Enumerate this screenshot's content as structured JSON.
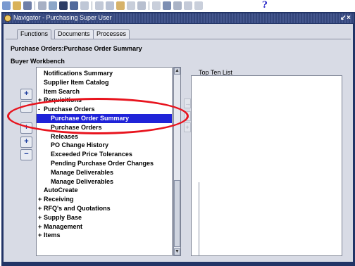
{
  "window": {
    "title": "Navigator - Purchasing Super User",
    "controls": [
      "↙",
      "×"
    ]
  },
  "toolbar": {
    "help_label": "?"
  },
  "tabs": [
    {
      "label": "Functions",
      "active": true
    },
    {
      "label": "Documents",
      "active": false
    },
    {
      "label": "Processes",
      "active": false
    }
  ],
  "breadcrumb": "Purchase Orders:Purchase Order Summary",
  "section_title": "Buyer Workbench",
  "side_buttons": [
    "+",
    "−",
    "+",
    "+",
    "−"
  ],
  "tree": {
    "items": [
      {
        "label": "Notifications Summary",
        "expander": "",
        "level": 0
      },
      {
        "label": "Supplier Item Catalog",
        "expander": "",
        "level": 0
      },
      {
        "label": "Item Search",
        "expander": "",
        "level": 0
      },
      {
        "label": "Requisitions",
        "expander": "+",
        "level": 0
      },
      {
        "label": "Purchase Orders",
        "expander": "-",
        "level": 0
      },
      {
        "label": "Purchase Order Summary",
        "expander": "",
        "level": 1,
        "selected": true
      },
      {
        "label": "Purchase Orders",
        "expander": "",
        "level": 1
      },
      {
        "label": "Releases",
        "expander": "",
        "level": 1
      },
      {
        "label": "PO Change History",
        "expander": "",
        "level": 1
      },
      {
        "label": "Exceeded Price Tolerances",
        "expander": "",
        "level": 1
      },
      {
        "label": "Pending Purchase Order Changes",
        "expander": "",
        "level": 1
      },
      {
        "label": "Manage Deliverables",
        "expander": "",
        "level": 1
      },
      {
        "label": "Manage Deliverables",
        "expander": "",
        "level": 1
      },
      {
        "label": "AutoCreate",
        "expander": "",
        "level": 0
      },
      {
        "label": "Receiving",
        "expander": "+",
        "level": 0
      },
      {
        "label": "RFQ's and Quotations",
        "expander": "+",
        "level": 0
      },
      {
        "label": "Supply Base",
        "expander": "+",
        "level": 0
      },
      {
        "label": "Management",
        "expander": "+",
        "level": 0
      },
      {
        "label": "Items",
        "expander": "+",
        "level": 0
      }
    ]
  },
  "scroll": {
    "up": "▲",
    "down": "▼"
  },
  "middle_buttons": [
    "→",
    "←",
    "+"
  ],
  "top_ten": {
    "label": "Top Ten List"
  },
  "colors": {
    "selection": "#1f23d8",
    "annotation": "#e8141e",
    "title_bar": "#3a4c82"
  }
}
